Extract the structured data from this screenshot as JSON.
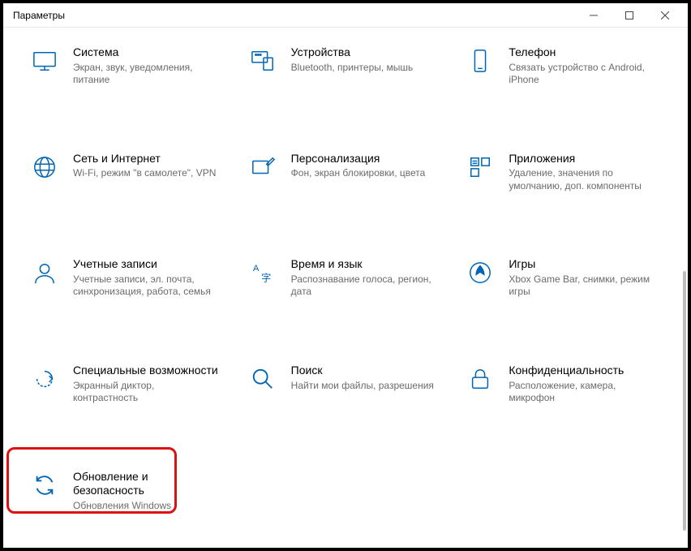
{
  "window": {
    "title": "Параметры"
  },
  "tiles": [
    {
      "key": "system",
      "title": "Система",
      "desc": "Экран, звук, уведомления, питание"
    },
    {
      "key": "devices",
      "title": "Устройства",
      "desc": "Bluetooth, принтеры, мышь"
    },
    {
      "key": "phone",
      "title": "Телефон",
      "desc": "Связать устройство с Android, iPhone"
    },
    {
      "key": "network",
      "title": "Сеть и Интернет",
      "desc": "Wi-Fi, режим \"в самолете\", VPN"
    },
    {
      "key": "personalize",
      "title": "Персонализация",
      "desc": "Фон, экран блокировки, цвета"
    },
    {
      "key": "apps",
      "title": "Приложения",
      "desc": "Удаление, значения по умолчанию, доп. компоненты"
    },
    {
      "key": "accounts",
      "title": "Учетные записи",
      "desc": "Учетные записи, эл. почта, синхронизация, работа, семья"
    },
    {
      "key": "time",
      "title": "Время и язык",
      "desc": "Распознавание голоса, регион, дата"
    },
    {
      "key": "gaming",
      "title": "Игры",
      "desc": "Xbox Game Bar, снимки, режим игры"
    },
    {
      "key": "ease",
      "title": "Специальные возможности",
      "desc": "Экранный диктор, контрастность"
    },
    {
      "key": "search",
      "title": "Поиск",
      "desc": "Найти мои файлы, разрешения"
    },
    {
      "key": "privacy",
      "title": "Конфиденциальность",
      "desc": "Расположение, камера, микрофон"
    },
    {
      "key": "update",
      "title": "Обновление и безопасность",
      "desc": "Обновления Windows"
    }
  ]
}
